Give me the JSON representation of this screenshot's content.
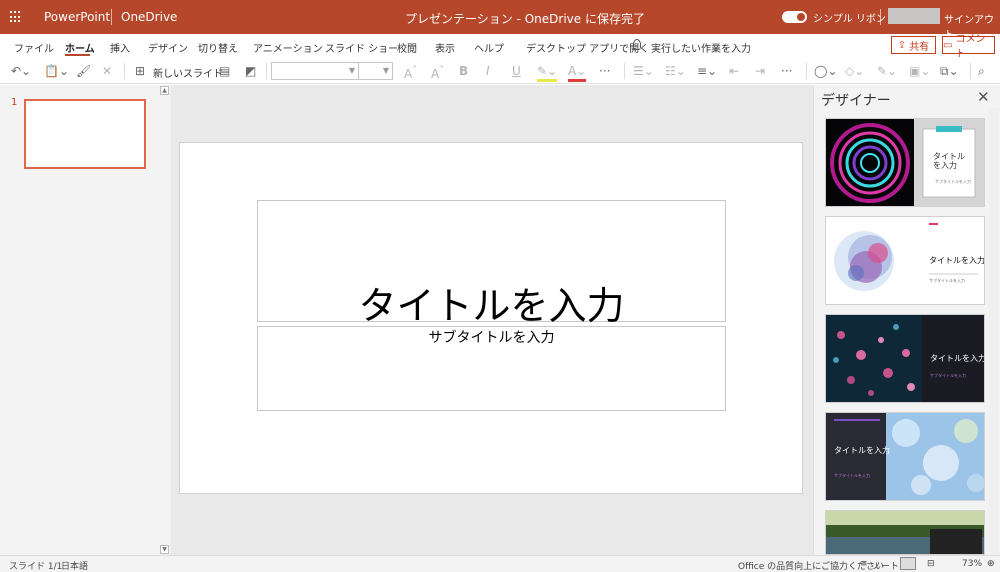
{
  "titlebar": {
    "app_name": "PowerPoint",
    "location": "OneDrive",
    "document_title": "プレゼンテーション  -  OneDrive に保存完了",
    "simple_ribbon_label": "シンプル リボン",
    "signout_label": "サインアウト",
    "bg_color": "#b7472a"
  },
  "menu": {
    "tabs": [
      "ファイル",
      "ホーム",
      "挿入",
      "デザイン",
      "切り替え",
      "アニメーション",
      "スライド ショー",
      "校閲",
      "表示",
      "ヘルプ",
      "デスクトップ アプリで開く"
    ],
    "active_tab": "ホーム",
    "tell_me": "実行したい作業を入力",
    "share_label": "共有",
    "comment_label": "コメント"
  },
  "ribbon": {
    "new_slide_label": "新しいスライド",
    "more": "···"
  },
  "thumbnails": {
    "slide_number": "1"
  },
  "slide": {
    "title_placeholder": "タイトルを入力",
    "subtitle_placeholder": "サブタイトルを入力"
  },
  "designer": {
    "title": "デザイナー",
    "ideas": [
      {
        "title": "タイトル\nを入力",
        "subtitle": "サブタイトルを入力"
      },
      {
        "title": "タイトルを入力",
        "subtitle": "サブタイトルを入力"
      },
      {
        "title": "タイトルを入力",
        "subtitle": "サブタイトルを入力"
      },
      {
        "title": "タイトルを入力",
        "subtitle": "サブタイトルを入力"
      }
    ]
  },
  "statusbar": {
    "slide_count": "スライド 1/1",
    "language": "日本語",
    "feedback": "Office の品質向上にご協力ください",
    "notes": "ノート",
    "zoom": "73%"
  }
}
